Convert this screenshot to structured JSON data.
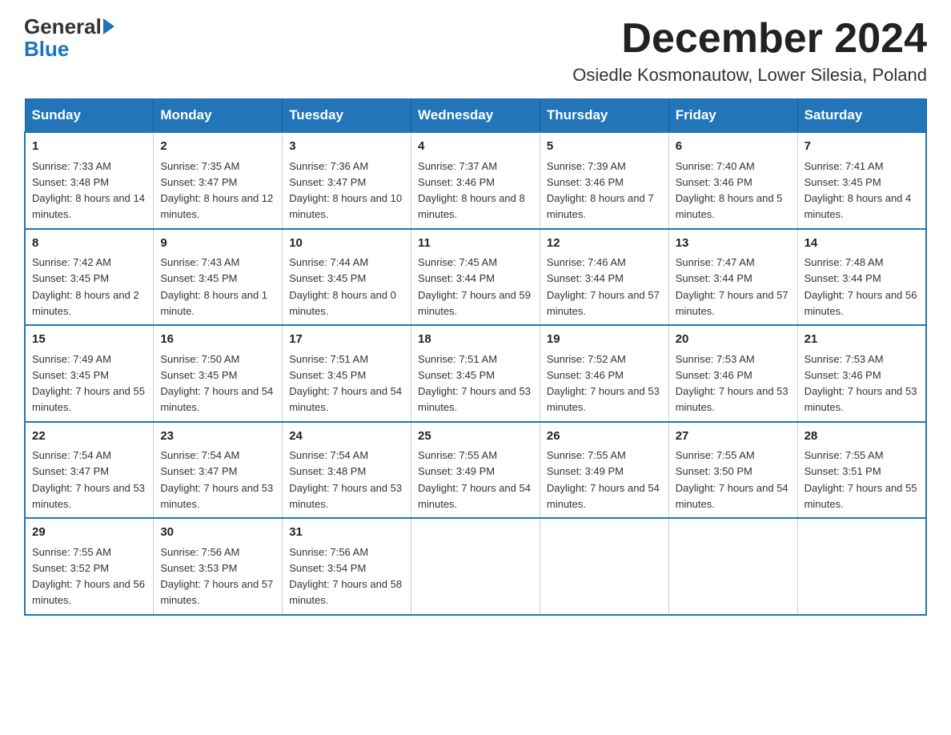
{
  "header": {
    "logo_general": "General",
    "logo_blue": "Blue",
    "month_title": "December 2024",
    "location": "Osiedle Kosmonautow, Lower Silesia, Poland"
  },
  "days_of_week": [
    "Sunday",
    "Monday",
    "Tuesday",
    "Wednesday",
    "Thursday",
    "Friday",
    "Saturday"
  ],
  "weeks": [
    [
      {
        "day": "1",
        "sunrise": "7:33 AM",
        "sunset": "3:48 PM",
        "daylight": "8 hours and 14 minutes."
      },
      {
        "day": "2",
        "sunrise": "7:35 AM",
        "sunset": "3:47 PM",
        "daylight": "8 hours and 12 minutes."
      },
      {
        "day": "3",
        "sunrise": "7:36 AM",
        "sunset": "3:47 PM",
        "daylight": "8 hours and 10 minutes."
      },
      {
        "day": "4",
        "sunrise": "7:37 AM",
        "sunset": "3:46 PM",
        "daylight": "8 hours and 8 minutes."
      },
      {
        "day": "5",
        "sunrise": "7:39 AM",
        "sunset": "3:46 PM",
        "daylight": "8 hours and 7 minutes."
      },
      {
        "day": "6",
        "sunrise": "7:40 AM",
        "sunset": "3:46 PM",
        "daylight": "8 hours and 5 minutes."
      },
      {
        "day": "7",
        "sunrise": "7:41 AM",
        "sunset": "3:45 PM",
        "daylight": "8 hours and 4 minutes."
      }
    ],
    [
      {
        "day": "8",
        "sunrise": "7:42 AM",
        "sunset": "3:45 PM",
        "daylight": "8 hours and 2 minutes."
      },
      {
        "day": "9",
        "sunrise": "7:43 AM",
        "sunset": "3:45 PM",
        "daylight": "8 hours and 1 minute."
      },
      {
        "day": "10",
        "sunrise": "7:44 AM",
        "sunset": "3:45 PM",
        "daylight": "8 hours and 0 minutes."
      },
      {
        "day": "11",
        "sunrise": "7:45 AM",
        "sunset": "3:44 PM",
        "daylight": "7 hours and 59 minutes."
      },
      {
        "day": "12",
        "sunrise": "7:46 AM",
        "sunset": "3:44 PM",
        "daylight": "7 hours and 57 minutes."
      },
      {
        "day": "13",
        "sunrise": "7:47 AM",
        "sunset": "3:44 PM",
        "daylight": "7 hours and 57 minutes."
      },
      {
        "day": "14",
        "sunrise": "7:48 AM",
        "sunset": "3:44 PM",
        "daylight": "7 hours and 56 minutes."
      }
    ],
    [
      {
        "day": "15",
        "sunrise": "7:49 AM",
        "sunset": "3:45 PM",
        "daylight": "7 hours and 55 minutes."
      },
      {
        "day": "16",
        "sunrise": "7:50 AM",
        "sunset": "3:45 PM",
        "daylight": "7 hours and 54 minutes."
      },
      {
        "day": "17",
        "sunrise": "7:51 AM",
        "sunset": "3:45 PM",
        "daylight": "7 hours and 54 minutes."
      },
      {
        "day": "18",
        "sunrise": "7:51 AM",
        "sunset": "3:45 PM",
        "daylight": "7 hours and 53 minutes."
      },
      {
        "day": "19",
        "sunrise": "7:52 AM",
        "sunset": "3:46 PM",
        "daylight": "7 hours and 53 minutes."
      },
      {
        "day": "20",
        "sunrise": "7:53 AM",
        "sunset": "3:46 PM",
        "daylight": "7 hours and 53 minutes."
      },
      {
        "day": "21",
        "sunrise": "7:53 AM",
        "sunset": "3:46 PM",
        "daylight": "7 hours and 53 minutes."
      }
    ],
    [
      {
        "day": "22",
        "sunrise": "7:54 AM",
        "sunset": "3:47 PM",
        "daylight": "7 hours and 53 minutes."
      },
      {
        "day": "23",
        "sunrise": "7:54 AM",
        "sunset": "3:47 PM",
        "daylight": "7 hours and 53 minutes."
      },
      {
        "day": "24",
        "sunrise": "7:54 AM",
        "sunset": "3:48 PM",
        "daylight": "7 hours and 53 minutes."
      },
      {
        "day": "25",
        "sunrise": "7:55 AM",
        "sunset": "3:49 PM",
        "daylight": "7 hours and 54 minutes."
      },
      {
        "day": "26",
        "sunrise": "7:55 AM",
        "sunset": "3:49 PM",
        "daylight": "7 hours and 54 minutes."
      },
      {
        "day": "27",
        "sunrise": "7:55 AM",
        "sunset": "3:50 PM",
        "daylight": "7 hours and 54 minutes."
      },
      {
        "day": "28",
        "sunrise": "7:55 AM",
        "sunset": "3:51 PM",
        "daylight": "7 hours and 55 minutes."
      }
    ],
    [
      {
        "day": "29",
        "sunrise": "7:55 AM",
        "sunset": "3:52 PM",
        "daylight": "7 hours and 56 minutes."
      },
      {
        "day": "30",
        "sunrise": "7:56 AM",
        "sunset": "3:53 PM",
        "daylight": "7 hours and 57 minutes."
      },
      {
        "day": "31",
        "sunrise": "7:56 AM",
        "sunset": "3:54 PM",
        "daylight": "7 hours and 58 minutes."
      },
      null,
      null,
      null,
      null
    ]
  ]
}
